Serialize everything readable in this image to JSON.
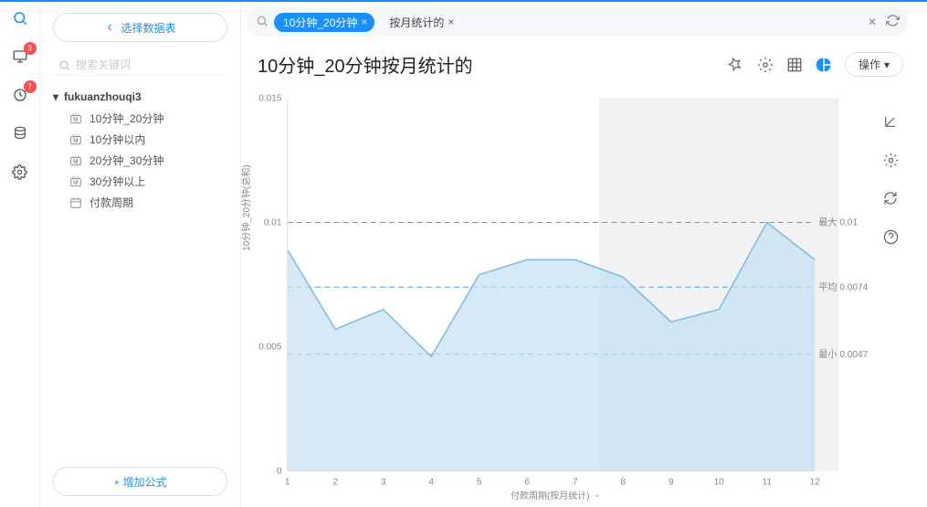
{
  "rail": {
    "items": [
      {
        "name": "search",
        "badge": null
      },
      {
        "name": "presentation",
        "badge": "3"
      },
      {
        "name": "notifications",
        "badge": "7"
      },
      {
        "name": "data",
        "badge": null
      },
      {
        "name": "settings",
        "badge": null
      }
    ]
  },
  "sidebar": {
    "select_table": "选择数据表",
    "search_placeholder": "搜索关键词",
    "group": {
      "name": "fukuanzhouqi3"
    },
    "items": [
      {
        "label": "10分钟_20分钟",
        "icon": "number"
      },
      {
        "label": "10分钟以内",
        "icon": "number"
      },
      {
        "label": "20分钟_30分钟",
        "icon": "number"
      },
      {
        "label": "30分钟以上",
        "icon": "number"
      },
      {
        "label": "付款周期",
        "icon": "date"
      }
    ],
    "add_formula": "+ 增加公式"
  },
  "topbar": {
    "pills": [
      {
        "label": "10分钟_20分钟",
        "style": "blue"
      },
      {
        "label": "按月统计的",
        "style": "plain"
      }
    ]
  },
  "header": {
    "title": "10分钟_20分钟按月统计的",
    "operate": "操作",
    "icons": [
      "pin",
      "settings",
      "table",
      "chart"
    ]
  },
  "chart_data": {
    "type": "area",
    "title": "",
    "xlabel": "付款周期(按月统计)",
    "ylabel": "10分钟_20分钟(总和)",
    "categories": [
      "1",
      "2",
      "3",
      "4",
      "5",
      "6",
      "7",
      "8",
      "9",
      "10",
      "11",
      "12"
    ],
    "values": [
      0.0089,
      0.0057,
      0.0065,
      0.0046,
      0.0079,
      0.0085,
      0.0085,
      0.0078,
      0.006,
      0.0065,
      0.01,
      0.0085
    ],
    "yticks": [
      0,
      0.005,
      0.01,
      0.015
    ],
    "ylim": [
      0,
      0.015
    ],
    "reference_lines": {
      "max": {
        "label": "最大 0.01",
        "value": 0.01
      },
      "mean": {
        "label": "平均 0.0074",
        "value": 0.0074
      },
      "min": {
        "label": "最小 0.0047",
        "value": 0.0047
      }
    },
    "highlight_band": {
      "from_index": 8,
      "to_index": 12
    },
    "colors": {
      "line": "#7fbce0",
      "area": "#c3e0f2",
      "ref": "#4aa3e0",
      "band": "#e4e6ea"
    }
  },
  "right_tools": [
    "edit-axis",
    "config",
    "refresh",
    "help"
  ]
}
